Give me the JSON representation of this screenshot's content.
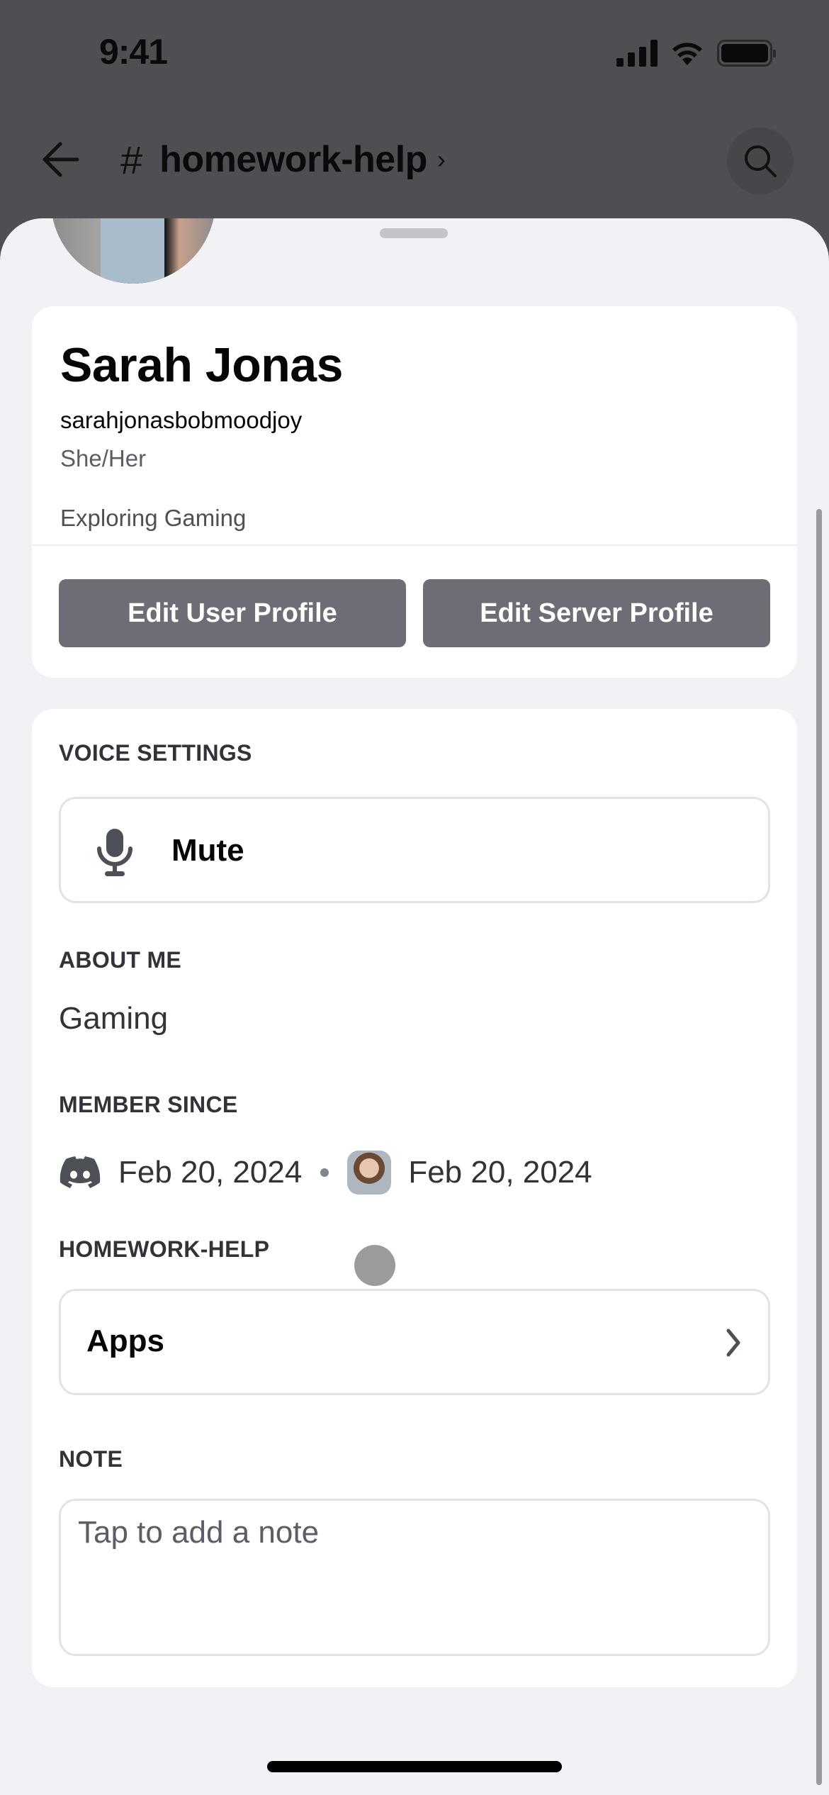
{
  "status_bar": {
    "time": "9:41",
    "icons": [
      "cellular-signal-icon",
      "wifi-icon",
      "battery-icon"
    ]
  },
  "header": {
    "back_icon": "arrow-left-icon",
    "channel_prefix": "#",
    "channel_name": "homework-help",
    "chevron": "›",
    "search_icon": "search-icon"
  },
  "profile": {
    "display_name": "Sarah Jonas",
    "username": "sarahjonasbobmoodjoy",
    "pronouns": "She/Her",
    "custom_status": "Exploring Gaming",
    "buttons": {
      "edit_user_profile": "Edit User Profile",
      "edit_server_profile": "Edit Server Profile"
    }
  },
  "sections": {
    "voice_settings": {
      "label": "VOICE SETTINGS",
      "mute_label": "Mute",
      "icon": "microphone-icon"
    },
    "about_me": {
      "label": "ABOUT ME",
      "text": "Gaming"
    },
    "member_since": {
      "label": "MEMBER SINCE",
      "discord_date": "Feb 20, 2024",
      "server_date": "Feb 20, 2024"
    },
    "channel": {
      "label": "HOMEWORK-HELP",
      "apps_label": "Apps"
    },
    "note": {
      "label": "NOTE",
      "placeholder": "Tap to add a note",
      "value": ""
    }
  },
  "colors": {
    "button_bg": "#6c6d75",
    "sheet_bg": "#f2f2f6",
    "overlay_bg": "#4f4e52"
  }
}
